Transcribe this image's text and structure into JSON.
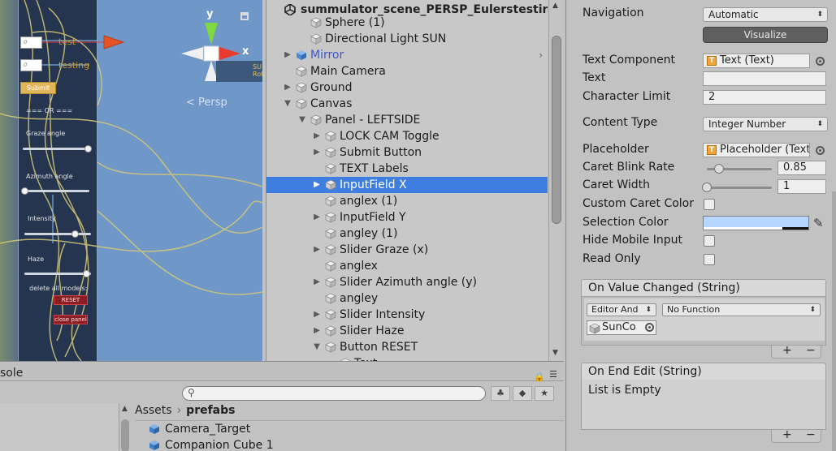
{
  "scene": {
    "field1_placeholder": "0",
    "field1_label": "test",
    "field2_placeholder": "0",
    "field2_label": "testing",
    "submit_label": "Submit",
    "or_text": "=== OR ===",
    "graze_label": "Graze angle",
    "azimuth_label": "Azimuth angle",
    "intensity_label": "Intensity",
    "haze_label": "Haze",
    "delete_text": "delete all models:",
    "reset_label": "RESET",
    "close_label": "close panel",
    "gizmo_y": "y",
    "gizmo_x": "x",
    "persp_label": "< Persp",
    "sun_text": "SU",
    "sun_text2": "Rota"
  },
  "hierarchy": {
    "scene_name": "summulator_scene_PERSP_Eulerstesting",
    "rows": [
      {
        "label": "Sphere (1)",
        "depth": 1,
        "expand": "",
        "style": ""
      },
      {
        "label": "Directional Light SUN",
        "depth": 1,
        "expand": "",
        "style": ""
      },
      {
        "label": "Mirror",
        "depth": 0,
        "expand": "▶",
        "style": "blue",
        "prefab": "›"
      },
      {
        "label": "Main Camera",
        "depth": 0,
        "expand": "",
        "style": ""
      },
      {
        "label": "Ground",
        "depth": 0,
        "expand": "▶",
        "style": ""
      },
      {
        "label": "Canvas",
        "depth": 0,
        "expand": "▼",
        "style": ""
      },
      {
        "label": "Panel - LEFTSIDE",
        "depth": 1,
        "expand": "▼",
        "style": ""
      },
      {
        "label": "LOCK CAM Toggle",
        "depth": 2,
        "expand": "▶",
        "style": ""
      },
      {
        "label": "Submit Button",
        "depth": 2,
        "expand": "▶",
        "style": ""
      },
      {
        "label": "TEXT Labels",
        "depth": 2,
        "expand": "",
        "style": ""
      },
      {
        "label": "InputField X",
        "depth": 2,
        "expand": "▶",
        "style": "sel"
      },
      {
        "label": "anglex (1)",
        "depth": 2,
        "expand": "",
        "style": ""
      },
      {
        "label": "InputField Y",
        "depth": 2,
        "expand": "▶",
        "style": ""
      },
      {
        "label": "angley (1)",
        "depth": 2,
        "expand": "",
        "style": ""
      },
      {
        "label": "Slider Graze (x)",
        "depth": 2,
        "expand": "▶",
        "style": ""
      },
      {
        "label": "anglex",
        "depth": 2,
        "expand": "",
        "style": ""
      },
      {
        "label": "Slider Azimuth angle  (y)",
        "depth": 2,
        "expand": "▶",
        "style": ""
      },
      {
        "label": "angley",
        "depth": 2,
        "expand": "",
        "style": ""
      },
      {
        "label": "Slider Intensity",
        "depth": 2,
        "expand": "▶",
        "style": ""
      },
      {
        "label": "Slider Haze",
        "depth": 2,
        "expand": "▶",
        "style": ""
      },
      {
        "label": "Button RESET",
        "depth": 2,
        "expand": "▼",
        "style": ""
      },
      {
        "label": "Text",
        "depth": 3,
        "expand": "",
        "style": ""
      }
    ]
  },
  "project": {
    "tab_label": "sole",
    "breadcrumb_root": "Assets",
    "breadcrumb_sep": "›",
    "breadcrumb_current": "prefabs",
    "assets": [
      "Camera_Target",
      "Companion Cube 1"
    ]
  },
  "inspector": {
    "navigation_label": "Navigation",
    "navigation_value": "Automatic",
    "visualize_label": "Visualize",
    "text_component_label": "Text Component",
    "text_component_value": "Text (Text)",
    "text_label": "Text",
    "text_value": "",
    "char_limit_label": "Character Limit",
    "char_limit_value": "2",
    "content_type_label": "Content Type",
    "content_type_value": "Integer Number",
    "placeholder_label": "Placeholder",
    "placeholder_value": "Placeholder (Text)",
    "caret_blink_label": "Caret Blink Rate",
    "caret_blink_value": "0.85",
    "caret_blink_fraction": 0.14,
    "caret_width_label": "Caret Width",
    "caret_width_value": "1",
    "caret_width_fraction": 0.0,
    "custom_caret_label": "Custom Caret Color",
    "custom_caret_checked": false,
    "selection_color_label": "Selection Color",
    "selection_color_hex": "#b6d7ff",
    "hide_mobile_label": "Hide Mobile Input",
    "hide_mobile_checked": false,
    "read_only_label": "Read Only",
    "read_only_checked": false,
    "on_value_changed_label": "On Value Changed (String)",
    "runtime_value": "Editor And",
    "function_value": "No Function",
    "target_object": "SunCo",
    "on_end_edit_label": "On End Edit (String)",
    "list_empty_text": "List is Empty",
    "plus": "+",
    "minus": "−"
  },
  "colors": {
    "selection": "#3d7ee0",
    "scene_bg": "#6f97c7",
    "panel_bg": "#25344f"
  }
}
